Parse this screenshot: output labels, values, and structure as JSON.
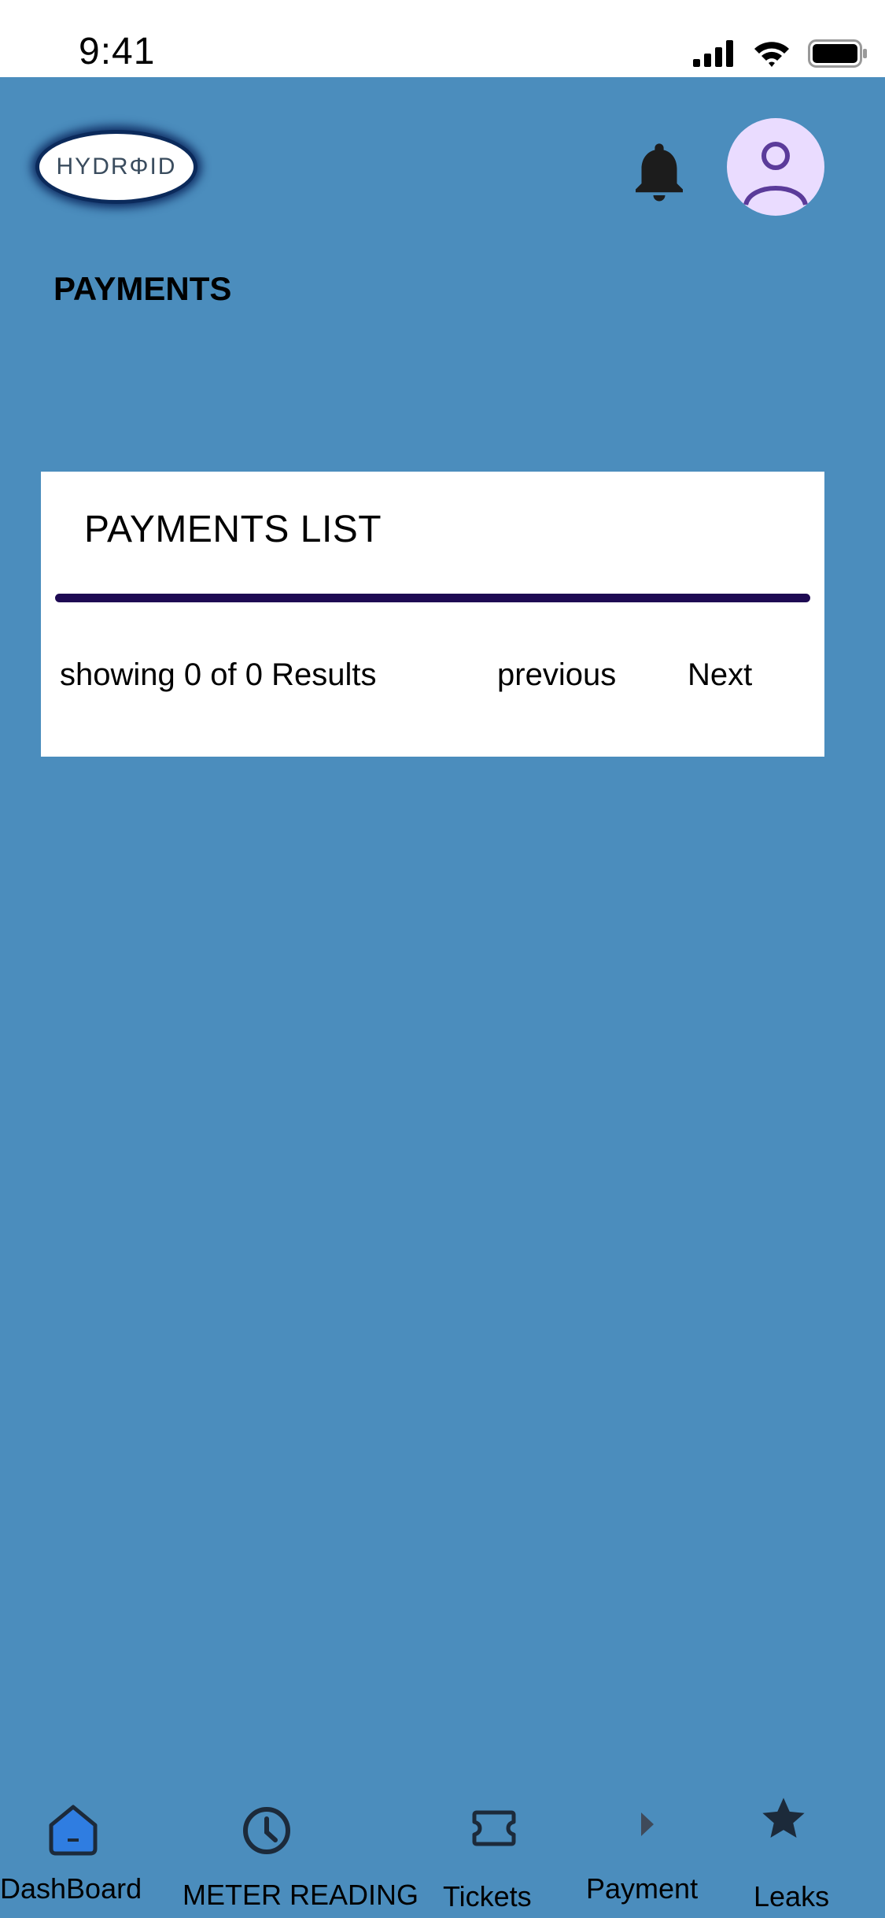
{
  "status_bar": {
    "time": "9:41"
  },
  "header": {
    "logo_text": "HYDRΦID",
    "page_title": "PAYMENTS"
  },
  "payments_card": {
    "title": "PAYMENTS LIST",
    "results_text": "showing 0 of  0 Results",
    "previous_label": "previous",
    "next_label": "Next"
  },
  "bottom_nav": {
    "items": [
      {
        "label": "DashBoard",
        "icon": "home-icon"
      },
      {
        "label": "METER READING",
        "icon": "clock-icon"
      },
      {
        "label": "Tickets",
        "icon": "ticket-icon"
      },
      {
        "label": "Payment",
        "icon": "play-icon"
      },
      {
        "label": "Leaks",
        "icon": "star-icon"
      }
    ]
  },
  "colors": {
    "background": "#4b8dbd",
    "card": "#ffffff",
    "divider": "#1e0a53",
    "avatar_bg": "#eadcff",
    "avatar_fg": "#5b3b9a",
    "home_icon_fill": "#2f7de1"
  }
}
